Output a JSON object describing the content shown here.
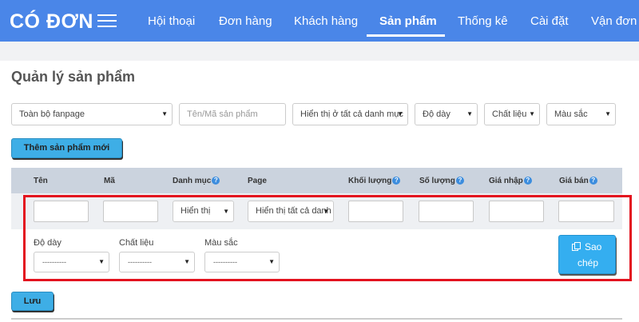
{
  "brand": "CÓ ĐƠN",
  "nav": [
    "Hội thoại",
    "Đơn hàng",
    "Khách hàng",
    "Sản phẩm",
    "Thống kê",
    "Cài đặt",
    "Vận đơn"
  ],
  "page_title": "Quản lý sản phẩm",
  "filters": {
    "fanpage": "Toàn bộ fanpage",
    "search_placeholder": "Tên/Mã sản phẩm",
    "category": "Hiển thị ở tất cả danh mục",
    "thickness": "Độ dày",
    "material": "Chất liệu",
    "color": "Màu sắc"
  },
  "add_button": "Thêm sản phẩm mới",
  "table": {
    "headers": [
      "Tên",
      "Mã",
      "Danh mục",
      "Page",
      "Khối lượng",
      "Số lượng",
      "Giá nhập",
      "Giá bán"
    ],
    "row": {
      "category_select": "Hiển thị",
      "page_select": "Hiển thị tất cả danh mục"
    },
    "attributes": {
      "thickness_label": "Độ dày",
      "material_label": "Chất liệu",
      "color_label": "Màu sắc",
      "placeholder": "----------"
    }
  },
  "copy_button": [
    "Sao",
    "chép"
  ],
  "save_button": "Lưu",
  "colors": {
    "navbar": "#4a86e8",
    "button": "#3eaee6",
    "highlight": "#e3131f"
  }
}
